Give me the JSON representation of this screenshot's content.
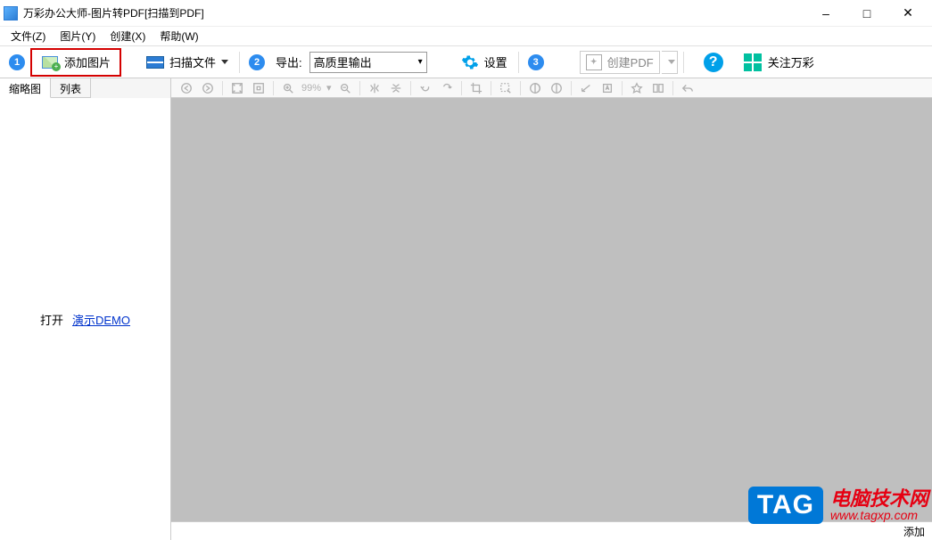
{
  "title": "万彩办公大师-图片转PDF[扫描到PDF]",
  "window_controls": {
    "min": "–",
    "max": "□",
    "close": "✕"
  },
  "menu": {
    "file": "文件(Z)",
    "image": "图片(Y)",
    "create": "创建(X)",
    "help": "帮助(W)"
  },
  "steps": {
    "s1": "1",
    "s2": "2",
    "s3": "3"
  },
  "toolbar": {
    "add_image": "添加图片",
    "scan_file": "扫描文件",
    "output_label": "导出:",
    "output_value": "高质里输出",
    "settings": "设置",
    "create_pdf": "创建PDF",
    "help": "?",
    "follow": "关注万彩"
  },
  "left": {
    "tab_thumb": "缩略图",
    "tab_list": "列表",
    "open": "打开",
    "demo": "演示DEMO"
  },
  "edit_toolbar": {
    "zoom": "99%",
    "zoom_dd": "▾"
  },
  "status": {
    "hint": "添加"
  },
  "watermark": {
    "tag": "TAG",
    "line1": "电脑技术网",
    "line2": "www.tagxp.com"
  }
}
